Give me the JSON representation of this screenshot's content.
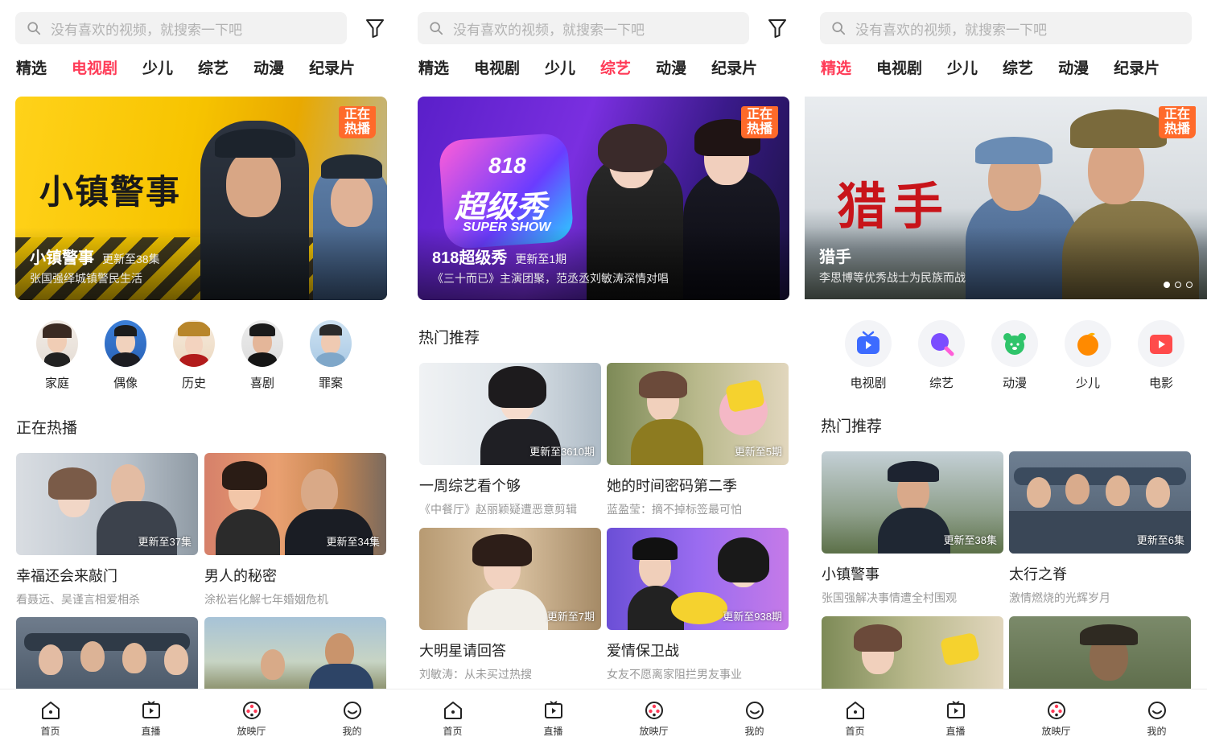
{
  "search": {
    "placeholder": "没有喜欢的视频，就搜索一下吧"
  },
  "tabs": [
    "精选",
    "电视剧",
    "少儿",
    "综艺",
    "动漫",
    "纪录片"
  ],
  "active_tab": {
    "screen1": "电视剧",
    "screen2": "综艺",
    "screen3": "精选"
  },
  "hot_badge": "正在热播",
  "screen1": {
    "banner": {
      "title": "小镇警事",
      "update": "更新至38集",
      "subtitle": "张国强绎城镇警民生活",
      "art_text": "小镇警事"
    },
    "categories": [
      "家庭",
      "偶像",
      "历史",
      "喜剧",
      "罪案"
    ],
    "section_title": "正在热播",
    "cards": [
      {
        "title": "幸福还会来敲门",
        "subtitle": "看聂远、吴谨言相爱相杀",
        "update": "更新至37集"
      },
      {
        "title": "男人的秘密",
        "subtitle": "涂松岩化解七年婚姻危机",
        "update": "更新至34集"
      }
    ]
  },
  "screen2": {
    "banner": {
      "title": "818超级秀",
      "update": "更新至1期",
      "subtitle": "《三十而已》主演团聚，范丞丞刘敏涛深情对唱",
      "art_text": "818",
      "art_text2": "超级秀",
      "art_text3": "SUPER SHOW"
    },
    "section_title": "热门推荐",
    "cards": [
      {
        "title": "一周综艺看个够",
        "subtitle": "《中餐厅》赵丽颖疑遭恶意剪辑",
        "update": "更新至3610期"
      },
      {
        "title": "她的时间密码第二季",
        "subtitle": "蓝盈莹：摘不掉标签最可怕",
        "update": "更新至5期"
      },
      {
        "title": "大明星请回答",
        "subtitle": "刘敏涛：从未买过热搜",
        "update": "更新至7期"
      },
      {
        "title": "爱情保卫战",
        "subtitle": "女友不愿离家阻拦男友事业",
        "update": "更新至938期"
      }
    ]
  },
  "screen3": {
    "banner": {
      "title": "猎手",
      "subtitle": "李思博等优秀战士为民族而战",
      "art_text": "猎手"
    },
    "categories": [
      {
        "label": "电视剧",
        "icon": "tv-icon",
        "color": "#3d6bff"
      },
      {
        "label": "综艺",
        "icon": "magnifier-variety-icon",
        "color": "#7b4dff"
      },
      {
        "label": "动漫",
        "icon": "bear-icon",
        "color": "#2fc46a"
      },
      {
        "label": "少儿",
        "icon": "orange-icon",
        "color": "#ff8a00"
      },
      {
        "label": "电影",
        "icon": "movie-icon",
        "color": "#ff4b4b"
      }
    ],
    "section_title": "热门推荐",
    "cards": [
      {
        "title": "小镇警事",
        "subtitle": "张国强解决事情遭全村围观",
        "update": "更新至38集"
      },
      {
        "title": "太行之脊",
        "subtitle": "激情燃烧的光辉岁月",
        "update": "更新至6集"
      }
    ]
  },
  "bottom_nav": [
    "首页",
    "直播",
    "放映厅",
    "我的"
  ],
  "colors": {
    "accent": "#ff3b57",
    "text": "#222222",
    "muted": "#9a9a9a"
  }
}
